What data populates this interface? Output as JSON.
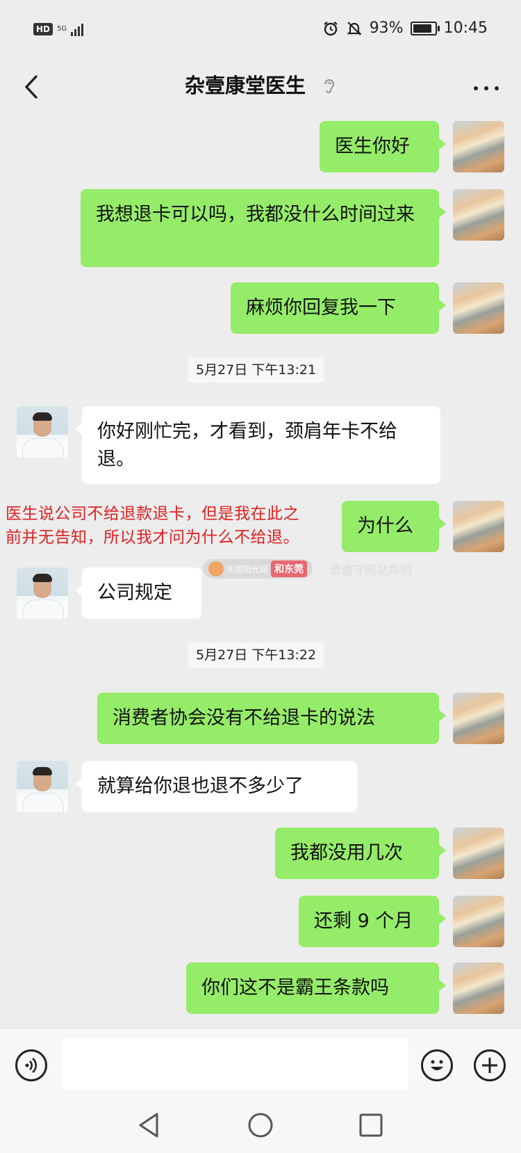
{
  "status_bar": {
    "hd": "HD",
    "network": "5G",
    "battery": "93%",
    "time": "10:45"
  },
  "header": {
    "title": "杂壹康堂医生"
  },
  "messages": [
    {
      "side": "me",
      "text": "医生你好"
    },
    {
      "side": "me",
      "text": "我想退卡可以吗，我都没什么时间过来"
    },
    {
      "side": "me",
      "text": "麻烦你回复我一下"
    },
    {
      "side": "them",
      "text": "你好刚忙完，才看到，颈肩年卡不给退。"
    },
    {
      "side": "me",
      "text": "为什么"
    },
    {
      "side": "them",
      "text": "公司规定"
    },
    {
      "side": "me",
      "text": "消费者协会没有不给退卡的说法"
    },
    {
      "side": "them",
      "text": "就算给你退也退不多少了"
    },
    {
      "side": "me",
      "text": "我都没用几次"
    },
    {
      "side": "me",
      "text": "还剩 9 个月"
    },
    {
      "side": "me",
      "text": "你们这不是霸王条款吗"
    }
  ],
  "timestamps": [
    "5月27日 下午13:21",
    "5月27日 下午13:22"
  ],
  "annotation": {
    "line1": "医生说公司不给退款退卡，但是我在此之",
    "line2": "前并无告知，所以我才问为什么不给退。",
    "color": "#e02020"
  },
  "watermark": {
    "site": "东莞阳光网",
    "brand": "和东莞",
    "tail": "请遵守网站声明"
  },
  "input": {
    "placeholder": ""
  },
  "colors": {
    "bg": "#ededed",
    "bubble_me": "#95ec69",
    "bubble_them": "#ffffff"
  },
  "icons": [
    "back-arrow-icon",
    "ear-icon",
    "more-icon",
    "voice-icon",
    "emoji-icon",
    "plus-icon",
    "nav-back-icon",
    "nav-home-icon",
    "nav-recent-icon",
    "alarm-icon",
    "mute-bell-icon"
  ]
}
